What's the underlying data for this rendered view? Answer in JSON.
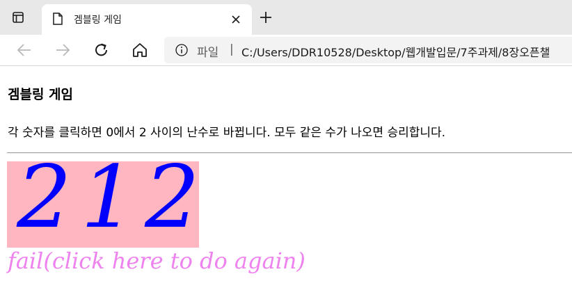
{
  "browser": {
    "tab": {
      "title": "겜블링 게임"
    },
    "address_bar": {
      "scheme_label": "파일",
      "separator": "|",
      "url": "C:/Users/DDR10528/Desktop/웹개발입문/7주과제/8장오픈챌"
    }
  },
  "page": {
    "heading": "겜블링 게임",
    "instructions": "각 숫자를 클릭하면 0에서 2 사이의 난수로 바뀝니다. 모두 같은 수가 나오면 승리합니다.",
    "digits": [
      "2",
      "1",
      "2"
    ],
    "result_text": "fail(click here to do again)"
  },
  "colors": {
    "digit_box_background": "#ffb6c1",
    "digit_color": "#0000ff",
    "result_color": "#ee82ee"
  },
  "icons": {
    "tab_actions": "tab-actions-icon",
    "page": "page-icon",
    "close": "close-icon",
    "new_tab": "plus-icon",
    "back": "arrow-left-icon",
    "forward": "arrow-right-icon",
    "refresh": "refresh-icon",
    "home": "home-icon",
    "info": "info-icon"
  }
}
